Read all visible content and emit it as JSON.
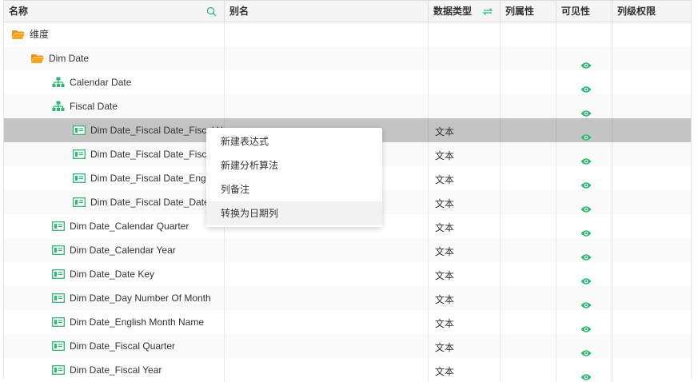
{
  "columns": {
    "name": "名称",
    "alias": "别名",
    "datatype": "数据类型",
    "attr": "列属性",
    "visible": "可见性",
    "perm": "列级权限"
  },
  "rows": [
    {
      "label": "维度",
      "icon": "folder-icon"
    },
    {
      "label": "Dim Date",
      "icon": "folder-icon"
    },
    {
      "label": "Calendar Date",
      "icon": "hierarchy-icon"
    },
    {
      "label": "Fiscal Date",
      "icon": "hierarchy-icon"
    },
    {
      "label": "Dim Date_Fiscal Date_Fiscal Year",
      "icon": "column-icon",
      "type": "文本"
    },
    {
      "label": "Dim Date_Fiscal Date_Fiscal Quarter",
      "icon": "column-icon",
      "type": "文本"
    },
    {
      "label": "Dim Date_Fiscal Date_English Month Name",
      "icon": "column-icon",
      "type": "文本"
    },
    {
      "label": "Dim Date_Fiscal Date_Date Key",
      "icon": "column-icon",
      "type": "文本"
    },
    {
      "label": "Dim Date_Calendar Quarter",
      "icon": "column-icon",
      "type": "文本"
    },
    {
      "label": "Dim Date_Calendar Year",
      "icon": "column-icon",
      "type": "文本"
    },
    {
      "label": "Dim Date_Date Key",
      "icon": "column-icon",
      "type": "文本"
    },
    {
      "label": "Dim Date_Day Number Of Month",
      "icon": "column-icon",
      "type": "文本"
    },
    {
      "label": "Dim Date_English Month Name",
      "icon": "column-icon",
      "type": "文本"
    },
    {
      "label": "Dim Date_Fiscal Quarter",
      "icon": "column-icon",
      "type": "文本"
    },
    {
      "label": "Dim Date_Fiscal Year",
      "icon": "column-icon",
      "type": "文本"
    }
  ],
  "context_menu": [
    "新建表达式",
    "新建分析算法",
    "列备注",
    "转换为日期列"
  ],
  "colors": {
    "accent": "#2eb872",
    "folder": "#f5a623",
    "selected_row": "#c4c4c4"
  }
}
